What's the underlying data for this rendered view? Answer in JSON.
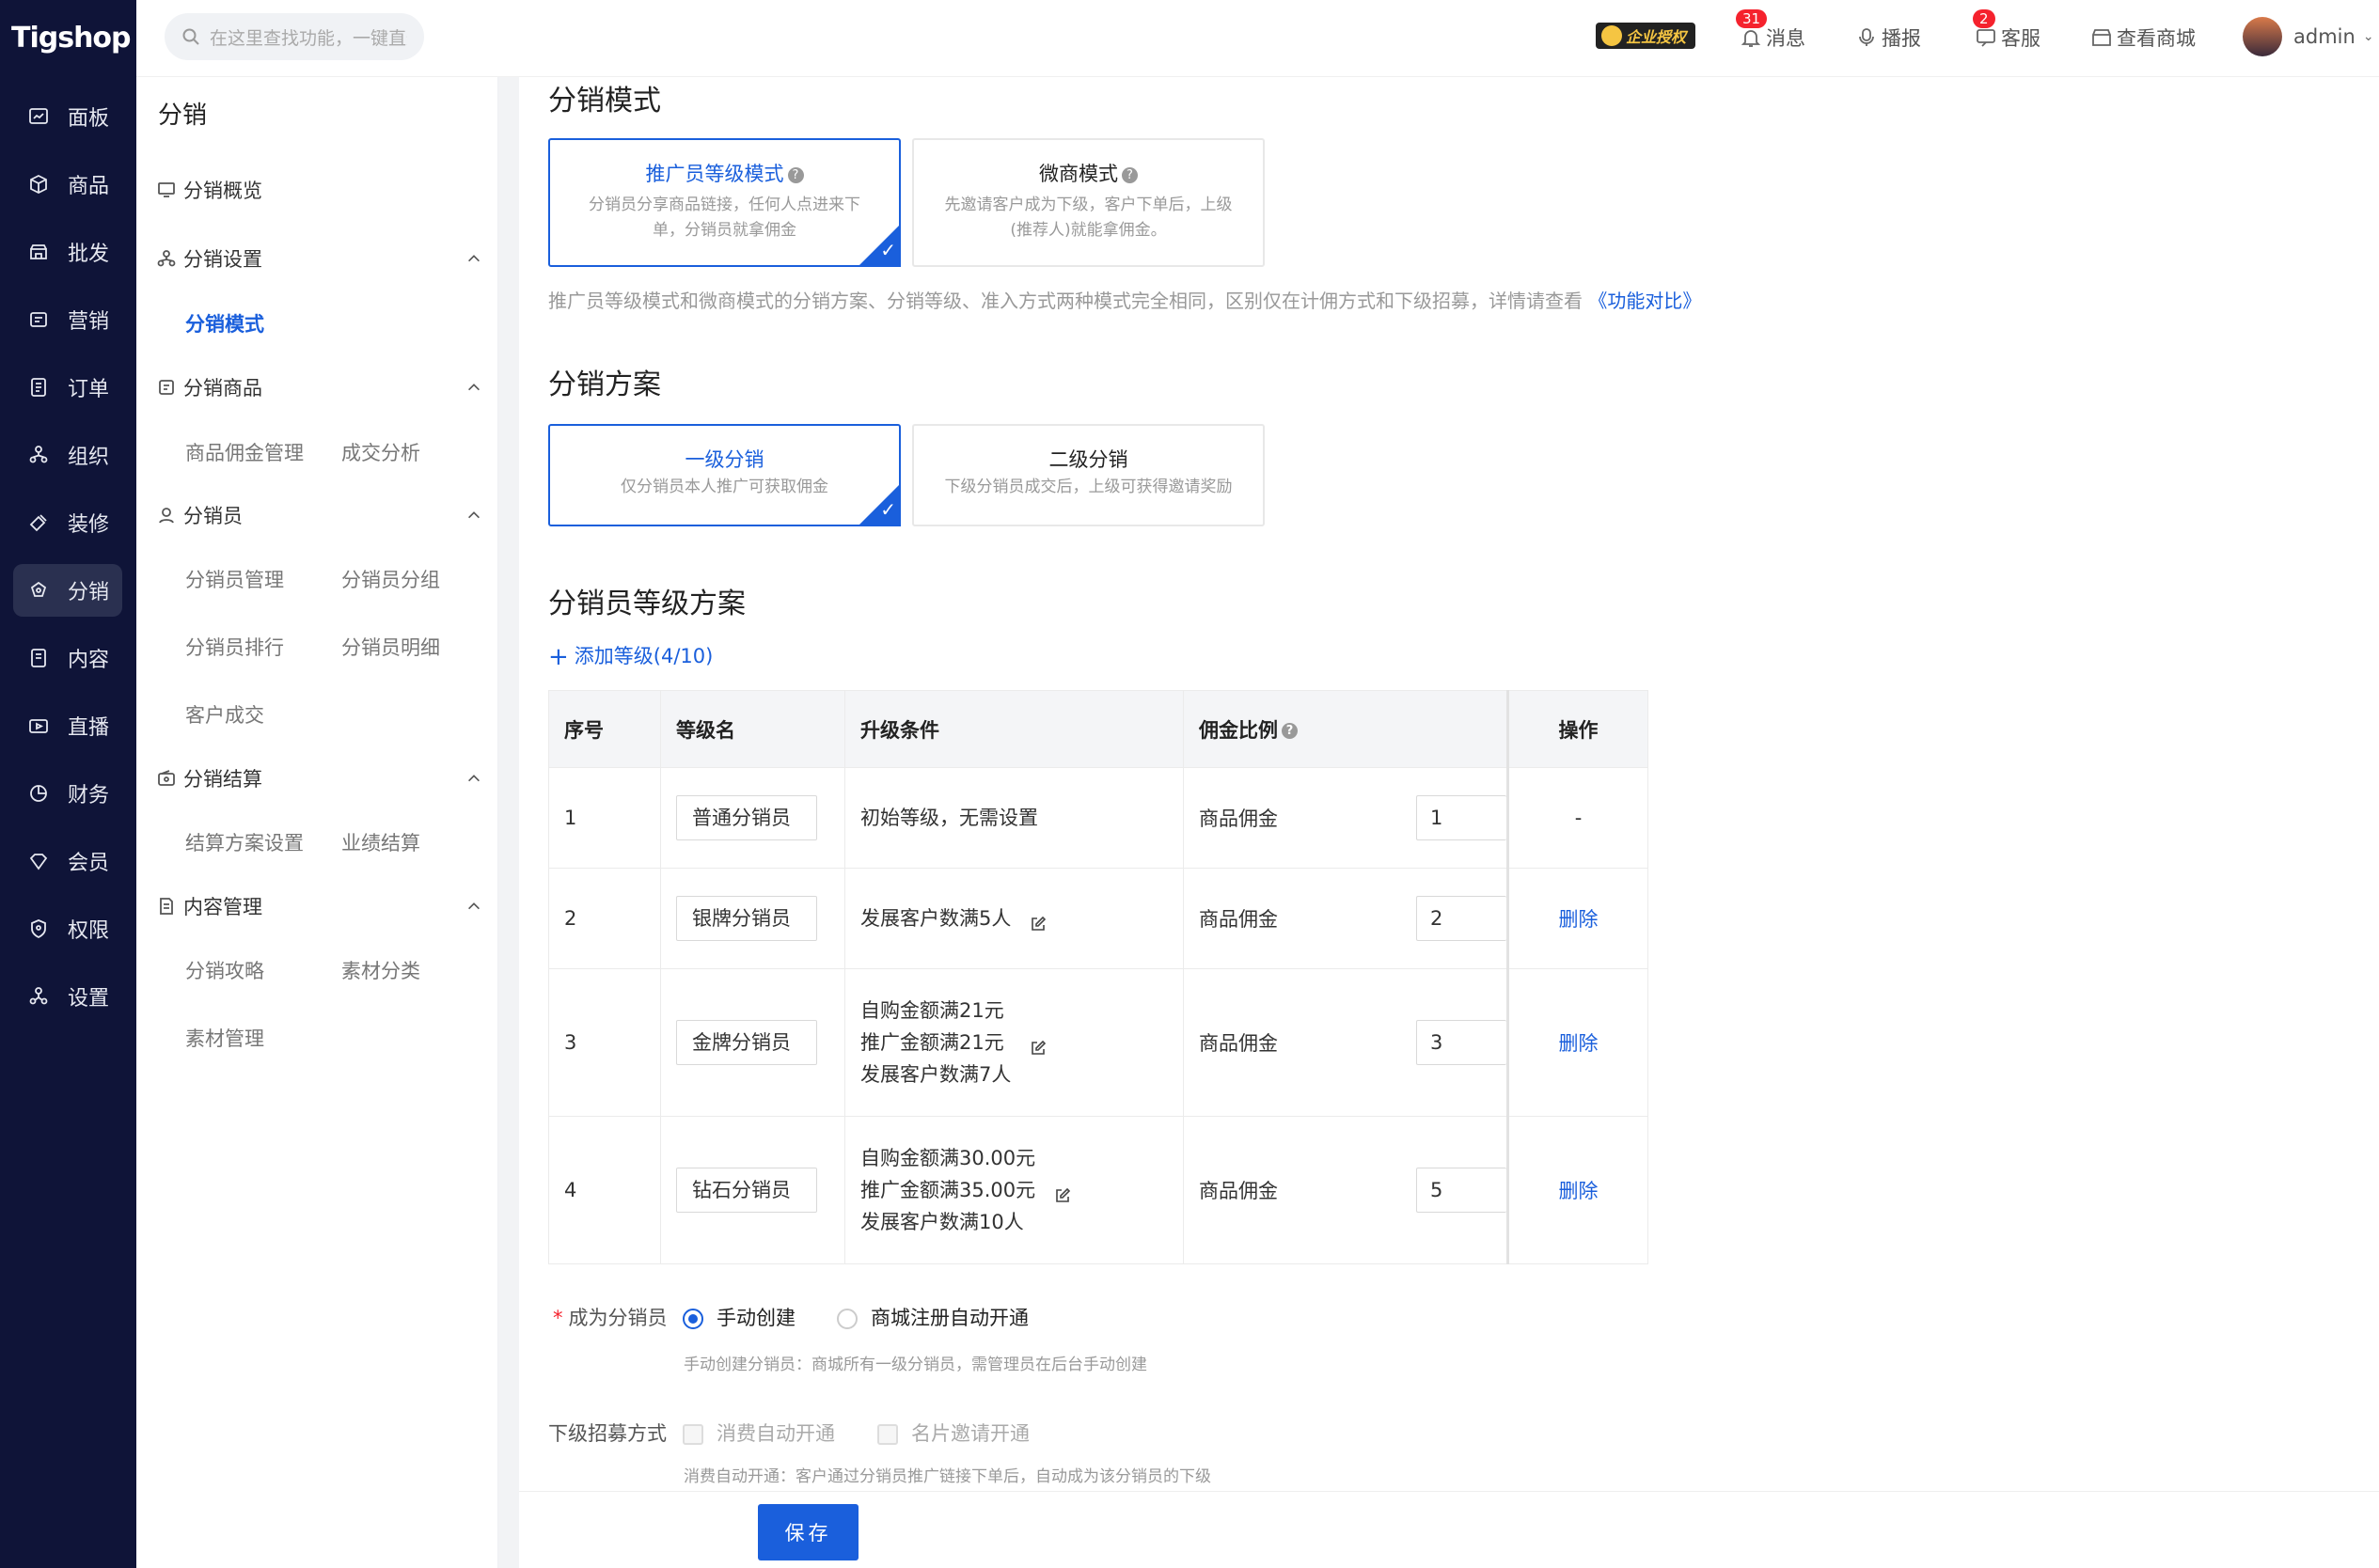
{
  "app": {
    "logo": "Tigshop"
  },
  "rail": [
    {
      "label": "面板",
      "icon": "dashboard-icon"
    },
    {
      "label": "商品",
      "icon": "box-icon"
    },
    {
      "label": "批发",
      "icon": "store-icon"
    },
    {
      "label": "营销",
      "icon": "marketing-icon"
    },
    {
      "label": "订单",
      "icon": "order-icon"
    },
    {
      "label": "组织",
      "icon": "org-icon"
    },
    {
      "label": "装修",
      "icon": "decorate-icon"
    },
    {
      "label": "分销",
      "icon": "distribution-icon",
      "active": true
    },
    {
      "label": "内容",
      "icon": "content-icon"
    },
    {
      "label": "直播",
      "icon": "live-icon"
    },
    {
      "label": "财务",
      "icon": "finance-icon"
    },
    {
      "label": "会员",
      "icon": "member-icon"
    },
    {
      "label": "权限",
      "icon": "permission-icon"
    },
    {
      "label": "设置",
      "icon": "settings-icon"
    }
  ],
  "topbar": {
    "search_placeholder": "在这里查找功能，一键直达",
    "license": "企业授权",
    "messages": {
      "label": "消息",
      "count": "31"
    },
    "broadcast": "播报",
    "service": {
      "label": "客服",
      "count": "2"
    },
    "view_store": "查看商城",
    "user": "admin"
  },
  "subnav": {
    "title": "分销",
    "groups": {
      "overview": "分销概览",
      "settings": "分销设置",
      "mode": "分销模式",
      "goods": "分销商品",
      "commission": "商品佣金管理",
      "analysis": "成交分析",
      "distributor": "分销员",
      "manage": "分销员管理",
      "group": "分销员分组",
      "rank": "分销员排行",
      "detail": "分销员明细",
      "deal": "客户成交",
      "settle": "分销结算",
      "plan": "结算方案设置",
      "perf": "业绩结算",
      "content": "内容管理",
      "guide": "分销攻略",
      "material_cat": "素材分类",
      "material": "素材管理"
    }
  },
  "mode_section": {
    "title": "分销模式",
    "cards": [
      {
        "title": "推广员等级模式",
        "desc": "分销员分享商品链接，任何人点进来下单，分销员就拿佣金"
      },
      {
        "title": "微商模式",
        "desc": "先邀请客户成为下级，客户下单后，上级(推荐人)就能拿佣金。"
      }
    ],
    "note": "推广员等级模式和微商模式的分销方案、分销等级、准入方式两种模式完全相同，区别仅在计佣方式和下级招募，详情请查看",
    "note_link": "《功能对比》"
  },
  "plan_section": {
    "title": "分销方案",
    "cards": [
      {
        "title": "一级分销",
        "desc": "仅分销员本人推广可获取佣金"
      },
      {
        "title": "二级分销",
        "desc": "下级分销员成交后，上级可获得邀请奖励"
      }
    ]
  },
  "level_section": {
    "title": "分销员等级方案",
    "add_label": "添加等级(4/10)",
    "headers": {
      "no": "序号",
      "name": "等级名",
      "cond": "升级条件",
      "rate": "佣金比例",
      "op": "操作"
    },
    "rows": [
      {
        "no": "1",
        "name": "普通分销员",
        "cond": [
          "初始等级，无需设置"
        ],
        "rate_label": "商品佣金",
        "rate": "1",
        "op": "-"
      },
      {
        "no": "2",
        "name": "银牌分销员",
        "cond": [
          "发展客户数满5人"
        ],
        "rate_label": "商品佣金",
        "rate": "2",
        "op": "删除"
      },
      {
        "no": "3",
        "name": "金牌分销员",
        "cond": [
          "自购金额满21元",
          "推广金额满21元",
          "发展客户数满7人"
        ],
        "rate_label": "商品佣金",
        "rate": "3",
        "op": "删除"
      },
      {
        "no": "4",
        "name": "钻石分销员",
        "cond": [
          "自购金额满30.00元",
          "推广金额满35.00元",
          "发展客户数满10人"
        ],
        "rate_label": "商品佣金",
        "rate": "5",
        "op": "删除"
      }
    ]
  },
  "become": {
    "label": "成为分销员",
    "opt1": "手动创建",
    "opt2": "商城注册自动开通",
    "hint": "手动创建分销员：商城所有一级分销员，需管理员在后台手动创建"
  },
  "recruit": {
    "label": "下级招募方式",
    "opt1": "消费自动开通",
    "opt2": "名片邀请开通",
    "hint": "消费自动开通：客户通过分销员推广链接下单后，自动成为该分销员的下级"
  },
  "save_label": "保存",
  "colors": {
    "accent": "#1a5fdc",
    "rail_bg": "#0f1438",
    "badge": "#f5222d"
  }
}
